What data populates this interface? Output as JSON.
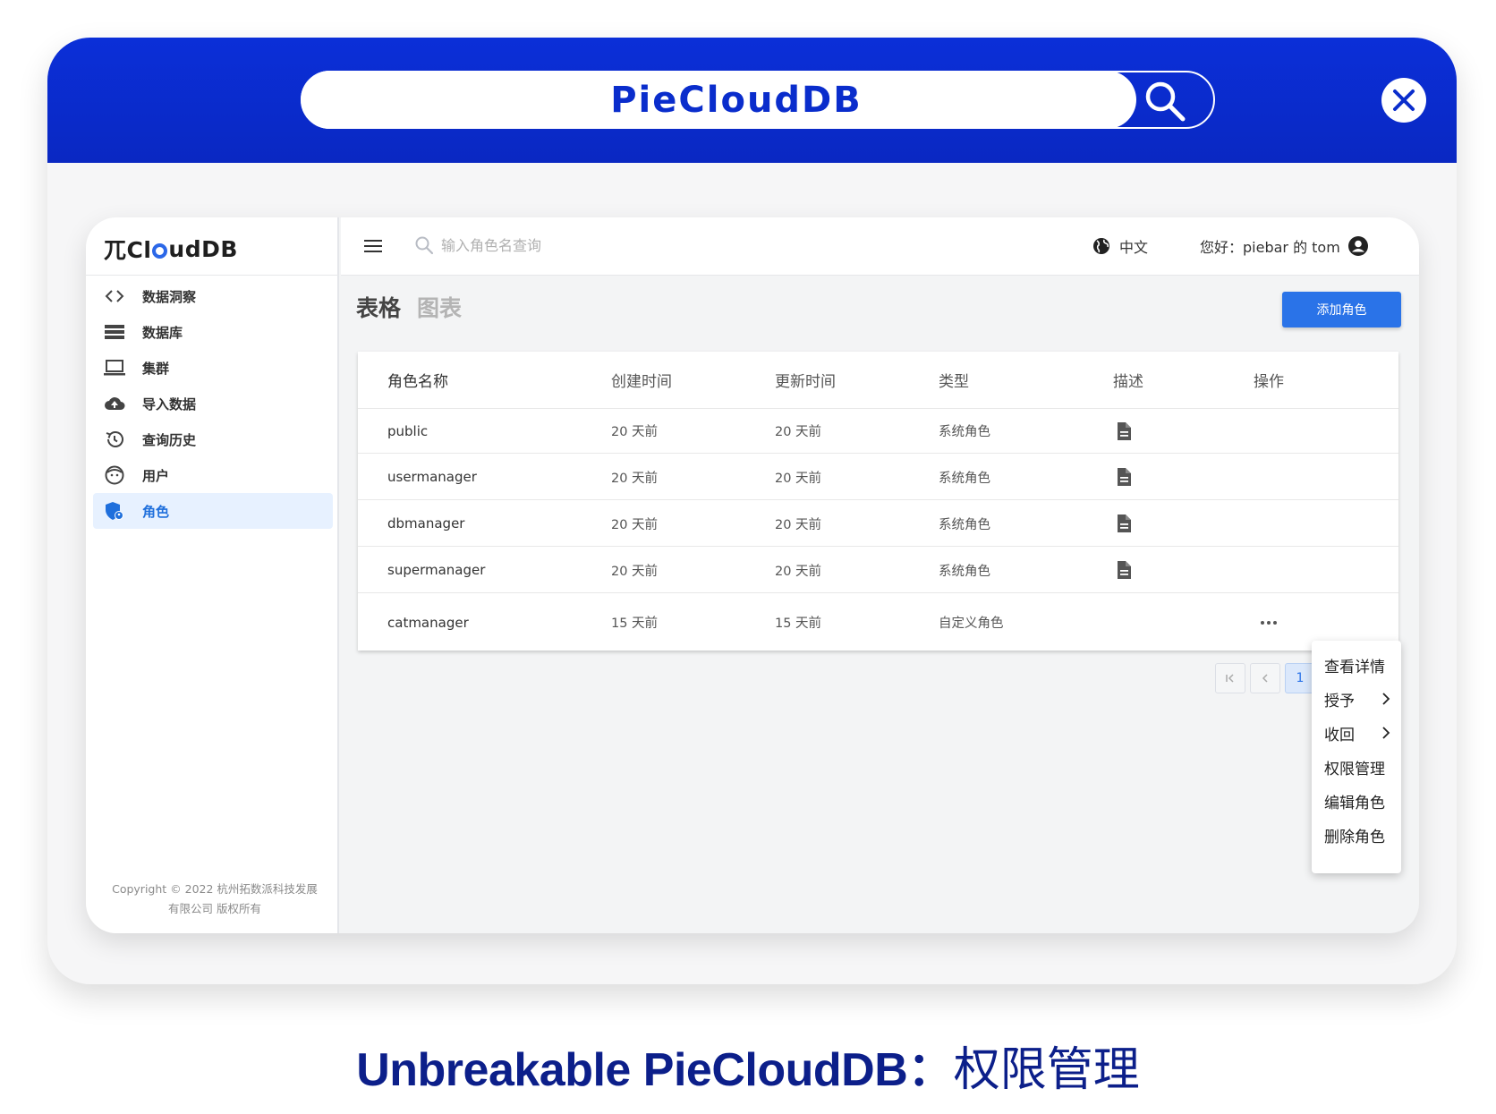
{
  "banner": {
    "search_text": "PieCloudDB"
  },
  "app": {
    "logo": {
      "prefix": "兀Cl",
      "suffix": "udDB"
    },
    "sidebar": {
      "items": [
        {
          "label": "数据洞察",
          "icon": "code-brackets-icon"
        },
        {
          "label": "数据库",
          "icon": "database-list-icon"
        },
        {
          "label": "集群",
          "icon": "laptop-icon"
        },
        {
          "label": "导入数据",
          "icon": "cloud-upload-icon"
        },
        {
          "label": "查询历史",
          "icon": "history-icon"
        },
        {
          "label": "用户",
          "icon": "user-face-icon"
        },
        {
          "label": "角色",
          "icon": "shield-user-icon"
        }
      ],
      "active_index": 6,
      "copyright_line1": "Copyright © 2022 杭州拓数派科技发展",
      "copyright_line2": "有限公司 版权所有"
    },
    "header": {
      "search_placeholder": "输入角色名查询",
      "language": "中文",
      "greeting": "您好：piebar 的 tom"
    },
    "tabs": {
      "table": "表格",
      "chart": "图表"
    },
    "add_role_label": "添加角色",
    "table": {
      "columns": [
        "角色名称",
        "创建时间",
        "更新时间",
        "类型",
        "描述",
        "操作"
      ],
      "rows": [
        {
          "name": "public",
          "created": "20 天前",
          "updated": "20 天前",
          "type": "系统角色",
          "has_desc": true
        },
        {
          "name": "usermanager",
          "created": "20 天前",
          "updated": "20 天前",
          "type": "系统角色",
          "has_desc": true
        },
        {
          "name": "dbmanager",
          "created": "20 天前",
          "updated": "20 天前",
          "type": "系统角色",
          "has_desc": true
        },
        {
          "name": "supermanager",
          "created": "20 天前",
          "updated": "20 天前",
          "type": "系统角色",
          "has_desc": true
        },
        {
          "name": "catmanager",
          "created": "15 天前",
          "updated": "15 天前",
          "type": "自定义角色",
          "has_desc": false,
          "has_actions": true
        }
      ]
    },
    "pagination": {
      "current_page": "1"
    },
    "context_menu": {
      "items": [
        {
          "label": "查看详情",
          "submenu": false
        },
        {
          "label": "授予",
          "submenu": true
        },
        {
          "label": "收回",
          "submenu": true
        },
        {
          "label": "权限管理",
          "submenu": false
        },
        {
          "label": "编辑角色",
          "submenu": false
        },
        {
          "label": "删除角色",
          "submenu": false
        }
      ]
    }
  },
  "footer": {
    "title_bold": "Unbreakable PieCloudDB：",
    "title_light": "权限管理"
  },
  "colors": {
    "banner_blue": "#0a2dcc",
    "primary_button": "#2a73e8",
    "active_nav_text": "#1f6fdc",
    "footer_navy": "#0c1f8a"
  }
}
